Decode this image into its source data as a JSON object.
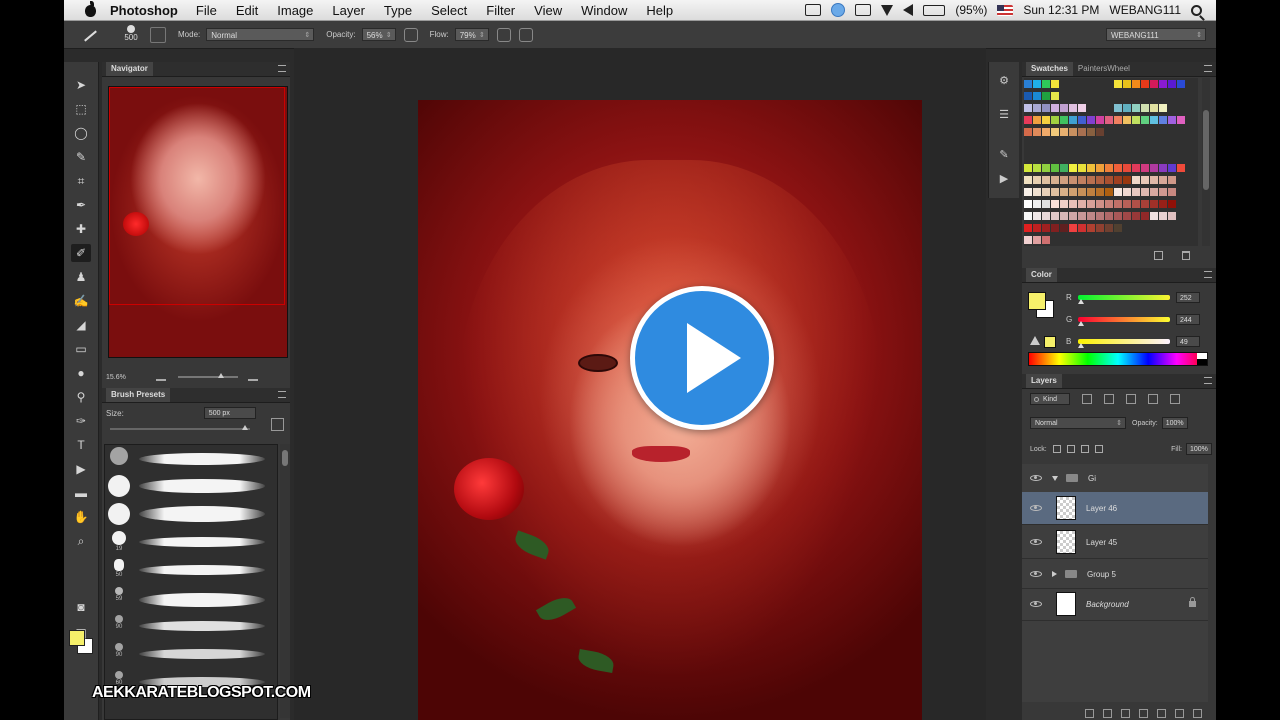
{
  "menubar": {
    "app_name": "Photoshop",
    "menus": [
      "File",
      "Edit",
      "Image",
      "Layer",
      "Type",
      "Select",
      "Filter",
      "View",
      "Window",
      "Help"
    ],
    "battery": "(95%)",
    "clock": "Sun 12:31 PM",
    "user": "WEBANG111"
  },
  "options": {
    "brush_size": "500",
    "mode_label": "Mode:",
    "mode_value": "Normal",
    "opacity_label": "Opacity:",
    "opacity_value": "56%",
    "flow_label": "Flow:",
    "flow_value": "79%",
    "workspace": "WEBANG111"
  },
  "navigator": {
    "title": "Navigator",
    "zoom": "15.6%"
  },
  "brush_presets": {
    "title": "Brush Presets",
    "size_label": "Size:",
    "size_value": "500 px",
    "tip_numbers": [
      "",
      "",
      "",
      "",
      "19",
      "50",
      "59",
      "90",
      "90",
      "60"
    ]
  },
  "swatches": {
    "tab_swatches": "Swatches",
    "tab_painters": "PaintersWheel"
  },
  "color": {
    "title": "Color",
    "channels": [
      {
        "label": "R",
        "value": "252"
      },
      {
        "label": "G",
        "value": "244"
      },
      {
        "label": "B",
        "value": "49"
      }
    ],
    "foreground": "#f6f06a",
    "background": "#ffffff"
  },
  "layers": {
    "title": "Layers",
    "kind": "Kind",
    "blend_mode": "Normal",
    "opacity_label": "Opacity:",
    "opacity_value": "100%",
    "lock_label": "Lock:",
    "fill_label": "Fill:",
    "fill_value": "100%",
    "items": [
      {
        "name": "Gi",
        "type": "group-open"
      },
      {
        "name": "Layer 46",
        "type": "layer",
        "selected": true
      },
      {
        "name": "Layer 45",
        "type": "layer"
      },
      {
        "name": "Group 5",
        "type": "group-closed"
      },
      {
        "name": "Background",
        "type": "background"
      }
    ]
  },
  "watermark": "AEKKARATEBLOGSPOT.COM"
}
